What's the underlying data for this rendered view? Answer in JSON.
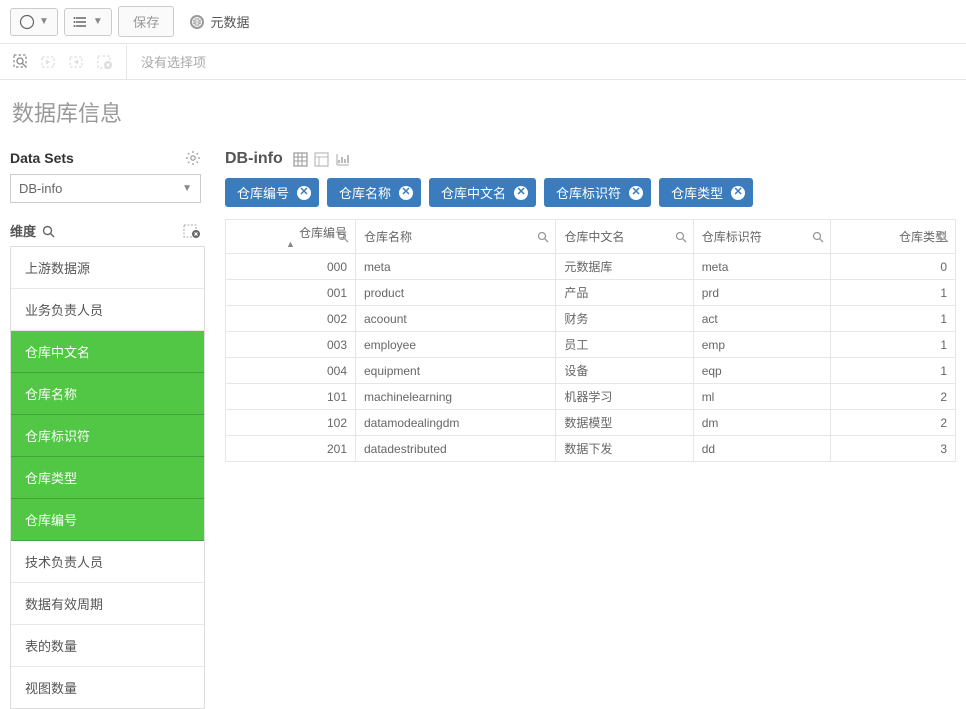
{
  "toolbar": {
    "save_label": "保存",
    "meta_label": "元数据"
  },
  "selection_bar": {
    "no_selection": "没有选择项"
  },
  "page_title": "数据库信息",
  "sidebar": {
    "data_sets_label": "Data Sets",
    "selected_dataset": "DB-info",
    "dimensions_label": "维度",
    "items": [
      {
        "label": "上游数据源",
        "selected": false
      },
      {
        "label": "业务负责人员",
        "selected": false
      },
      {
        "label": "仓库中文名",
        "selected": true
      },
      {
        "label": "仓库名称",
        "selected": true
      },
      {
        "label": "仓库标识符",
        "selected": true
      },
      {
        "label": "仓库类型",
        "selected": true
      },
      {
        "label": "仓库编号",
        "selected": true
      },
      {
        "label": "技术负责人员",
        "selected": false
      },
      {
        "label": "数据有效周期",
        "selected": false
      },
      {
        "label": "表的数量",
        "selected": false
      },
      {
        "label": "视图数量",
        "selected": false
      }
    ]
  },
  "main": {
    "title": "DB-info",
    "pills": [
      {
        "label": "仓库编号"
      },
      {
        "label": "仓库名称"
      },
      {
        "label": "仓库中文名"
      },
      {
        "label": "仓库标识符"
      },
      {
        "label": "仓库类型"
      }
    ],
    "columns": [
      {
        "label": "仓库编号",
        "numeric": true,
        "sorted": true
      },
      {
        "label": "仓库名称",
        "numeric": false
      },
      {
        "label": "仓库中文名",
        "numeric": false
      },
      {
        "label": "仓库标识符",
        "numeric": false
      },
      {
        "label": "仓库类型",
        "numeric": true
      }
    ],
    "rows": [
      {
        "c0": "000",
        "c1": "meta",
        "c2": "元数据库",
        "c3": "meta",
        "c4": "0"
      },
      {
        "c0": "001",
        "c1": "product",
        "c2": "产品",
        "c3": "prd",
        "c4": "1"
      },
      {
        "c0": "002",
        "c1": "acoount",
        "c2": "财务",
        "c3": "act",
        "c4": "1"
      },
      {
        "c0": "003",
        "c1": "employee",
        "c2": "员工",
        "c3": "emp",
        "c4": "1"
      },
      {
        "c0": "004",
        "c1": "equipment",
        "c2": "设备",
        "c3": "eqp",
        "c4": "1"
      },
      {
        "c0": "101",
        "c1": "machinelearning",
        "c2": "机器学习",
        "c3": "ml",
        "c4": "2"
      },
      {
        "c0": "102",
        "c1": "datamodealingdm",
        "c2": "数据模型",
        "c3": "dm",
        "c4": "2"
      },
      {
        "c0": "201",
        "c1": "datadestributed",
        "c2": "数据下发",
        "c3": "dd",
        "c4": "3"
      }
    ]
  }
}
